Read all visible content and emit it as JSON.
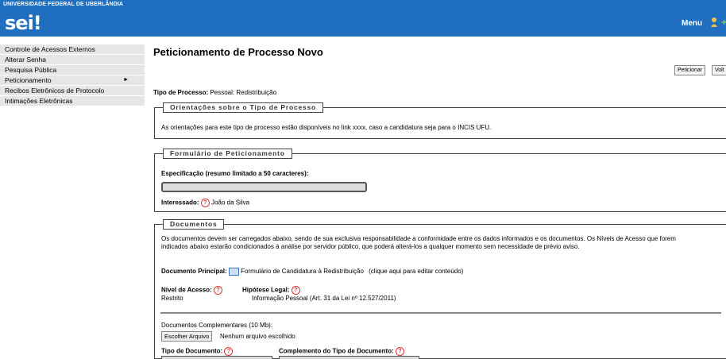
{
  "header": {
    "university": "UNIVERSIDADE FEDERAL DE UBERLÂNDIA",
    "logo": "sei!",
    "menu_label": "Menu",
    "icons": [
      "user-icon",
      "plus-icon"
    ],
    "bar_color": "#1f6ebf"
  },
  "sidebar": {
    "items": [
      {
        "label": "Controle de Acessos Externos"
      },
      {
        "label": "Alterar Senha"
      },
      {
        "label": "Pesquisa Pública"
      },
      {
        "label": "Peticionamento",
        "arrow": "►"
      },
      {
        "label": "Recibos Eletrônicos de Protocolo"
      },
      {
        "label": "Intimações Eletrônicas"
      }
    ]
  },
  "main": {
    "title": "Peticionamento de Processo Novo",
    "buttons": {
      "peticionar": "Peticionar",
      "voltar": "Volt"
    },
    "tipo_label": "Tipo de Processo:",
    "tipo_value": "Pessoal: Redistribuição",
    "orientacoes": {
      "legend": "Orientações sobre o Tipo de Processo",
      "text": "As orientações para este tipo de processo estão disponíveis no link xxxx, caso a candidatura seja para o INCIS UFU."
    },
    "formulario": {
      "legend": "Formulário de Peticionamento",
      "spec_label": "Especificação (resumo limitado a 50 caracteres):",
      "spec_value": "",
      "interessado_label": "Interessado:",
      "interessado_value": "João da Silva"
    },
    "documentos": {
      "legend": "Documentos",
      "intro_line1": "Os documentos devem ser carregados abaixo, sendo de sua exclusiva responsabilidade a conformidade entre os dados informados e os documentos. Os Níveis de Acesso que forem",
      "intro_line2": "indicados abaixo estarão condicionados à análise por servidor público, que poderá alterá-los a qualquer momento sem necessidade de prévio aviso.",
      "principal_label": "Documento Principal:",
      "principal_value": "Formulário de Candidatura à Redistribuição",
      "principal_hint": "(clique aqui para editar conteúdo)",
      "nivel_label": "Nível de Acesso:",
      "nivel_value": "Restrito",
      "hipotese_label": "Hipótese Legal:",
      "hipotese_value": "Informação Pessoal (Art. 31 da Lei nº 12.527/2011)",
      "complementares_label": "Documentos Complementares (10 Mb):",
      "file_button": "Escolher Arquivo",
      "file_status": "Nenhum arquivo escolhido",
      "tipo_doc_label": "Tipo de Documento:",
      "complemento_label": "Complemento do Tipo de Documento:"
    }
  }
}
